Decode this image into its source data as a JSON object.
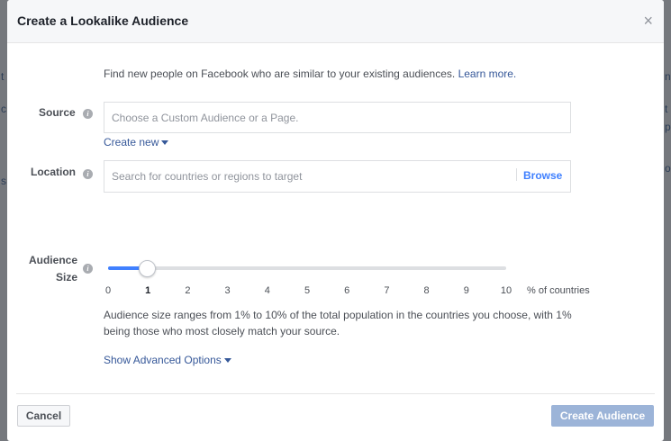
{
  "dialog": {
    "title": "Create a Lookalike Audience",
    "close_glyph": "×"
  },
  "intro": {
    "text": "Find new people on Facebook who are similar to your existing audiences.",
    "link": "Learn more."
  },
  "source": {
    "label": "Source",
    "placeholder": "Choose a Custom Audience or a Page.",
    "create_new": "Create new"
  },
  "location": {
    "label": "Location",
    "placeholder": "Search for countries or regions to target",
    "browse": "Browse"
  },
  "audience_size": {
    "label_line1": "Audience",
    "label_line2": "Size",
    "value_percent": 1,
    "ticks": [
      "0",
      "1",
      "2",
      "3",
      "4",
      "5",
      "6",
      "7",
      "8",
      "9",
      "10"
    ],
    "unit": "% of countries",
    "help": "Audience size ranges from 1% to 10% of the total population in the countries you choose, with 1% being those who most closely match your source."
  },
  "advanced": {
    "label": "Show Advanced Options"
  },
  "footer": {
    "cancel": "Cancel",
    "create": "Create Audience"
  },
  "background": {
    "left_fragments": [
      "t",
      "c",
      "s"
    ],
    "right_fragments": [
      "n",
      "t",
      "p",
      "o"
    ]
  },
  "colors": {
    "accent": "#4080ff",
    "link": "#365899",
    "create_disabled": "#9cb4d8"
  },
  "icons": {
    "info": "info-icon",
    "close": "close-icon",
    "caret": "caret-down-icon"
  }
}
